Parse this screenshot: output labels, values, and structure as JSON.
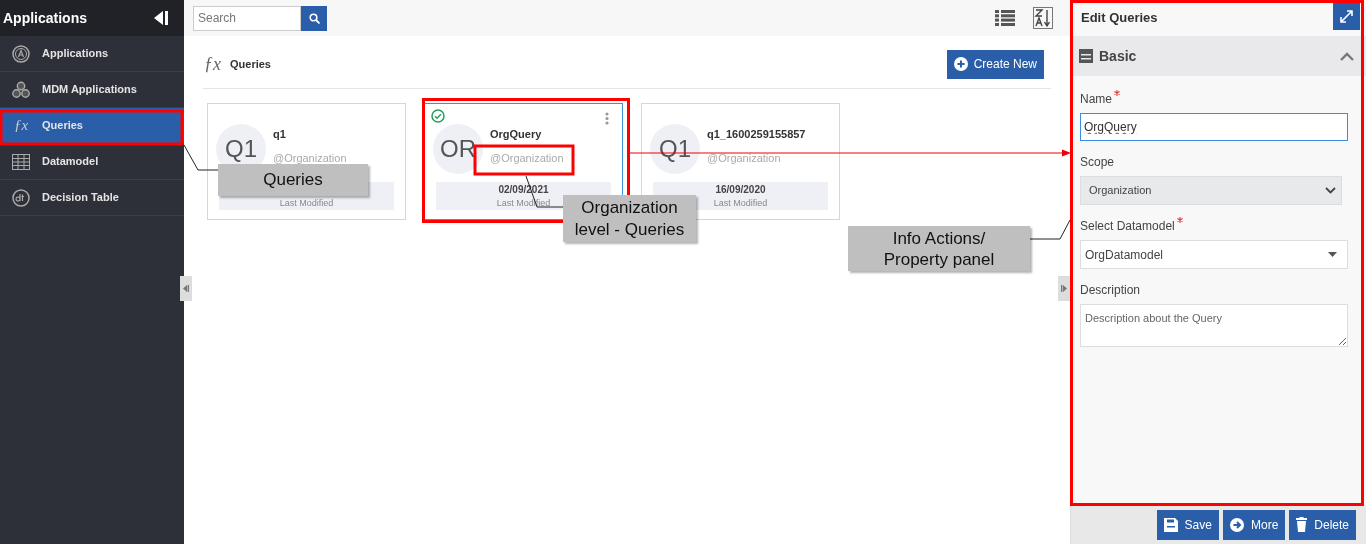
{
  "sidebar": {
    "title": "Applications",
    "items": [
      {
        "label": "Applications",
        "selected": false
      },
      {
        "label": "MDM Applications",
        "selected": false
      },
      {
        "label": "Queries",
        "glyph": "ƒx",
        "selected": true
      },
      {
        "label": "Datamodel",
        "selected": false
      },
      {
        "label": "Decision Table",
        "selected": false
      }
    ]
  },
  "search": {
    "placeholder": "Search"
  },
  "page_header": {
    "glyph": "ƒx",
    "title": "Queries",
    "create_button": "Create New"
  },
  "cards": [
    {
      "avatar": "Q1",
      "name": "q1",
      "scope": "@Organization",
      "caption": "Last Modified",
      "selected": false
    },
    {
      "avatar": "OR",
      "name": "OrgQuery",
      "scope": "@Organization",
      "date": "02/09/2021",
      "caption": "Last Modified",
      "selected": true
    },
    {
      "avatar": "Q1",
      "name": "q1_1600259155857",
      "scope": "@Organization",
      "date": "16/09/2020",
      "caption": "Last Modified",
      "selected": false
    }
  ],
  "panel": {
    "title": "Edit Queries",
    "section": {
      "title": "Basic",
      "expanded": true
    },
    "fields": [
      {
        "kind": "text",
        "label": "Name",
        "required": true,
        "value": "OrgQuery"
      },
      {
        "kind": "select",
        "label": "Scope",
        "required": false,
        "value": "Organization"
      },
      {
        "kind": "dropdown",
        "label": "Select Datamodel",
        "required": true,
        "value": "OrgDatamodel"
      },
      {
        "kind": "textarea",
        "label": "Description",
        "required": false,
        "placeholder": "Description about the Query"
      }
    ],
    "buttons": [
      "Save",
      "More",
      "Delete"
    ]
  },
  "annotations": [
    {
      "text": "Queries"
    },
    {
      "text": "Organization level - Queries"
    },
    {
      "text": "Info Actions/ Property panel"
    }
  ]
}
